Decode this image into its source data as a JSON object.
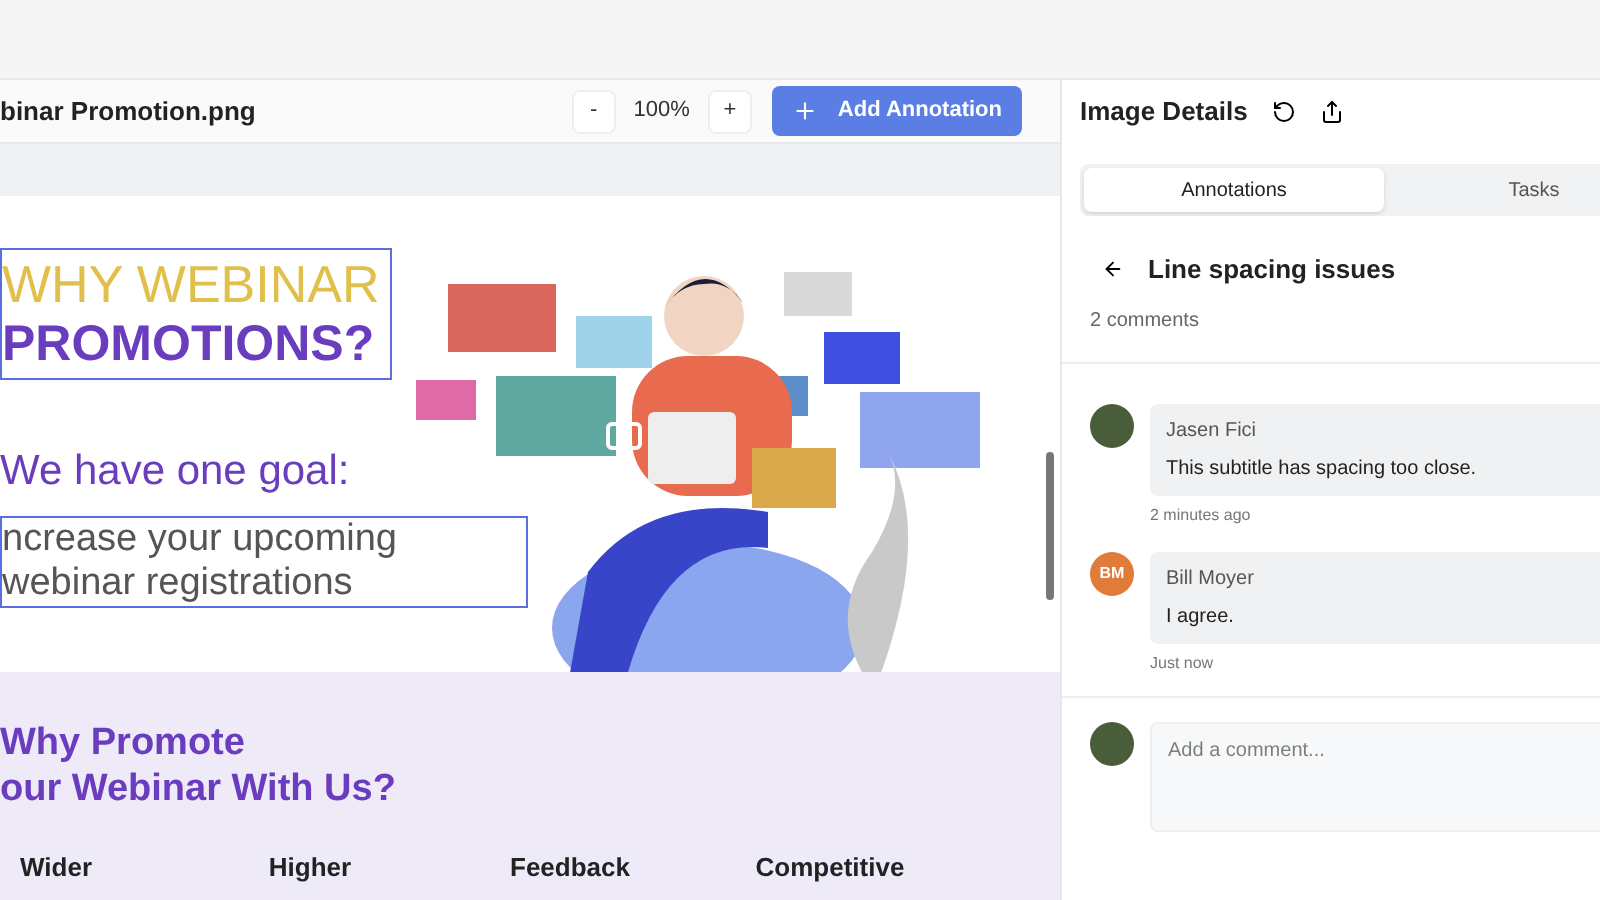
{
  "document": {
    "file_name": "binar Promotion.png"
  },
  "zoom": {
    "decrease": "-",
    "level": "100%",
    "increase": "+"
  },
  "add_button": {
    "label": "Add Annotation"
  },
  "poster": {
    "title_line_1": "WHY WEBINAR",
    "title_line_2": "PROMOTIONS?",
    "goal_heading": "We have one goal:",
    "goal_lines": [
      "ncrease your upcoming",
      "webinar registrations"
    ],
    "section_heading_lines": [
      "Why Promote",
      "our Webinar With Us?"
    ],
    "features": [
      "Wider",
      "Higher",
      "Feedback",
      "Competitive"
    ]
  },
  "details": {
    "title": "Image Details",
    "tabs": [
      {
        "label": "Annotations",
        "selected": true
      },
      {
        "label": "Tasks",
        "selected": false
      }
    ],
    "annotation": {
      "title": "Line spacing issues",
      "count": "2 comments"
    },
    "comments": [
      {
        "author": "Jasen Fici",
        "text": "This subtitle has spacing too close.",
        "time": "2 minutes ago",
        "avatar": {
          "kind": "photo"
        }
      },
      {
        "author": "Bill Moyer",
        "text": "I agree.",
        "time": "Just now",
        "avatar": {
          "kind": "initials",
          "initials": "BM",
          "color": "#e07b39"
        }
      }
    ],
    "composer": {
      "placeholder": "Add a comment...",
      "avatar": {
        "kind": "photo"
      }
    }
  }
}
